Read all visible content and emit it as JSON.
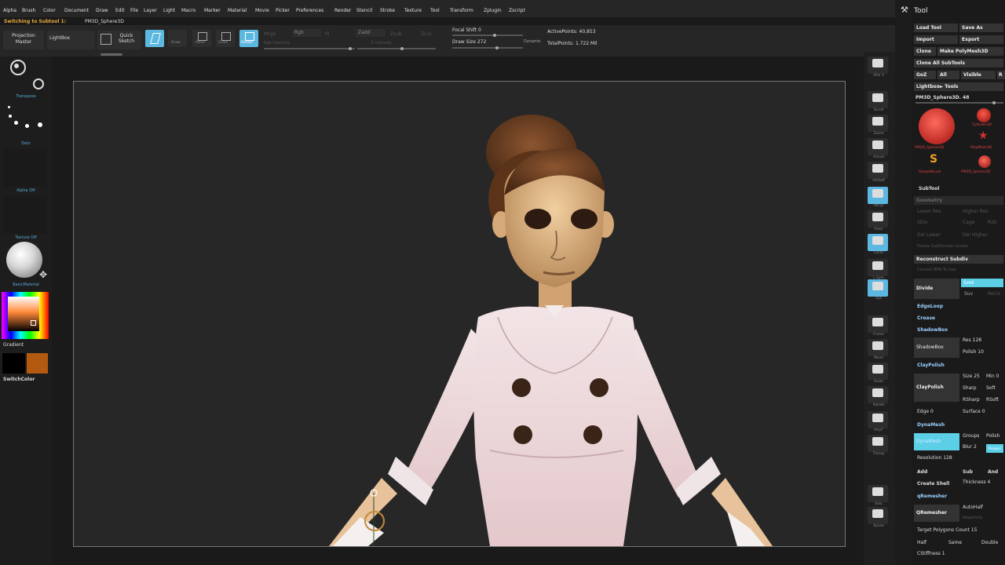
{
  "menu": [
    "Alpha",
    "Brush",
    "Color",
    "Document",
    "Draw",
    "Edit",
    "File",
    "Layer",
    "Light",
    "Macro",
    "Marker",
    "Material",
    "Movie",
    "Picker",
    "Preferences",
    "Render",
    "Stencil",
    "Stroke",
    "Texture",
    "Tool",
    "Transform",
    "Zplugin",
    "Zscript"
  ],
  "status": {
    "message": "Switching to Subtool 1:",
    "subtool_name": "PM3D_Sphere3D"
  },
  "toolbar": {
    "projection_master": "Projection Master",
    "lightbox": "LightBox",
    "quick_sketch": "Quick Sketch",
    "edit": "Edit",
    "draw": "Draw",
    "move": "Move",
    "scale": "Scale",
    "rotate": "Rotate",
    "mrgb": "Mrgb",
    "rgb": "Rgb",
    "m": "M",
    "zadd": "Zadd",
    "zsub": "Zsub",
    "zcut": "Zcut",
    "rgb_intensity": "Rgb Intensity",
    "z_intensity": "Z Intensity",
    "focal_shift_label": "Focal Shift",
    "focal_shift_value": "0",
    "draw_size_label": "Draw Size",
    "draw_size_value": "272",
    "dynamic": "Dynamic",
    "active_points": "ActivePoints: 40,853",
    "total_points": "TotalPoints: 1.722 Mil"
  },
  "left_shelf": {
    "brush": "Transpose",
    "stroke": "Dots",
    "alpha": "Alpha Off",
    "texture": "Texture Off",
    "material": "BasicMaterial",
    "gradient": "Gradient",
    "switch_color": "SwitchColor",
    "primary_color": "#ff8a3a",
    "secondary_color": "#000000",
    "alt_color": "#b35a10"
  },
  "right_shelf": [
    "SPix 3",
    "Scroll",
    "Zoom",
    "Actual",
    "AAHalf",
    "Persp",
    "Floor",
    "Local",
    "L.Sym",
    "Xyz",
    "Frame",
    "Move",
    "Scale",
    "Rotate",
    "PolyF",
    "Transp",
    "Solo",
    "Xpose"
  ],
  "tool_palette": {
    "title": "Tool",
    "load_tool": "Load Tool",
    "save_as": "Save As",
    "import": "Import",
    "export": "Export",
    "clone": "Clone",
    "make_polymesh": "Make PolyMesh3D",
    "clone_all": "Clone All SubTools",
    "goz": "GoZ",
    "all": "All",
    "visible": "Visible",
    "r": "R",
    "lightbox_tools": "Lightbox► Tools",
    "current_tool": "PM3D_Sphere3D. 48",
    "tools": [
      "PM3D_Sphere3D",
      "Cylinder3D",
      "PolyMesh3D",
      "SimpleBrush",
      "PM3D_Sphere3D"
    ],
    "subtool": "SubTool",
    "geometry": "Geometry",
    "lower_res": "Lower Res",
    "higher_res": "Higher Res",
    "sdiv": "SDiv",
    "cage": "Cage",
    "rstr": "Rstr",
    "del_lower": "Del Lower",
    "del_higher": "Del Higher",
    "freeze_subdiv": "Freeze SubDivision Levels",
    "reconstruct_subdiv": "Reconstruct Subdiv",
    "convert_bpr": "Convert BPR To Geo",
    "divide": "Divide",
    "smt": "Smt",
    "suv": "Suv",
    "reuv": "ReUV",
    "edgeloop": "EdgeLoop",
    "crease": "Crease",
    "shadowbox_head": "ShadowBox",
    "shadowbox": "ShadowBox",
    "res": "Res 128",
    "polish": "Polish 10",
    "claypolish_head": "ClayPolish",
    "claypolish": "ClayPolish",
    "size": "Size 25",
    "min": "Min 0",
    "sharp": "Sharp",
    "soft": "Soft",
    "rsharp": "RSharp",
    "rsoft": "RSoft",
    "edge": "Edge 0",
    "surface": "Surface 0",
    "dynamesh_head": "DynaMesh",
    "dynamesh": "DynaMesh",
    "groups": "Groups",
    "polish2": "Polish",
    "blur": "Blur 2",
    "project": "Project",
    "resolution": "Resolution 128",
    "add": "Add",
    "sub": "Sub",
    "and": "And",
    "create_shell": "Create Shell",
    "thickness": "Thickness 4",
    "qremesher_head": "qRemesher",
    "qremesher": "QRemesher",
    "autohalf": "AutoHalf",
    "adaptivity": "Adaptivity",
    "target": "Target Polygons Count 15",
    "half": "Half",
    "same": "Same",
    "double": "Double",
    "curves_strength": "CStiffness 1"
  }
}
